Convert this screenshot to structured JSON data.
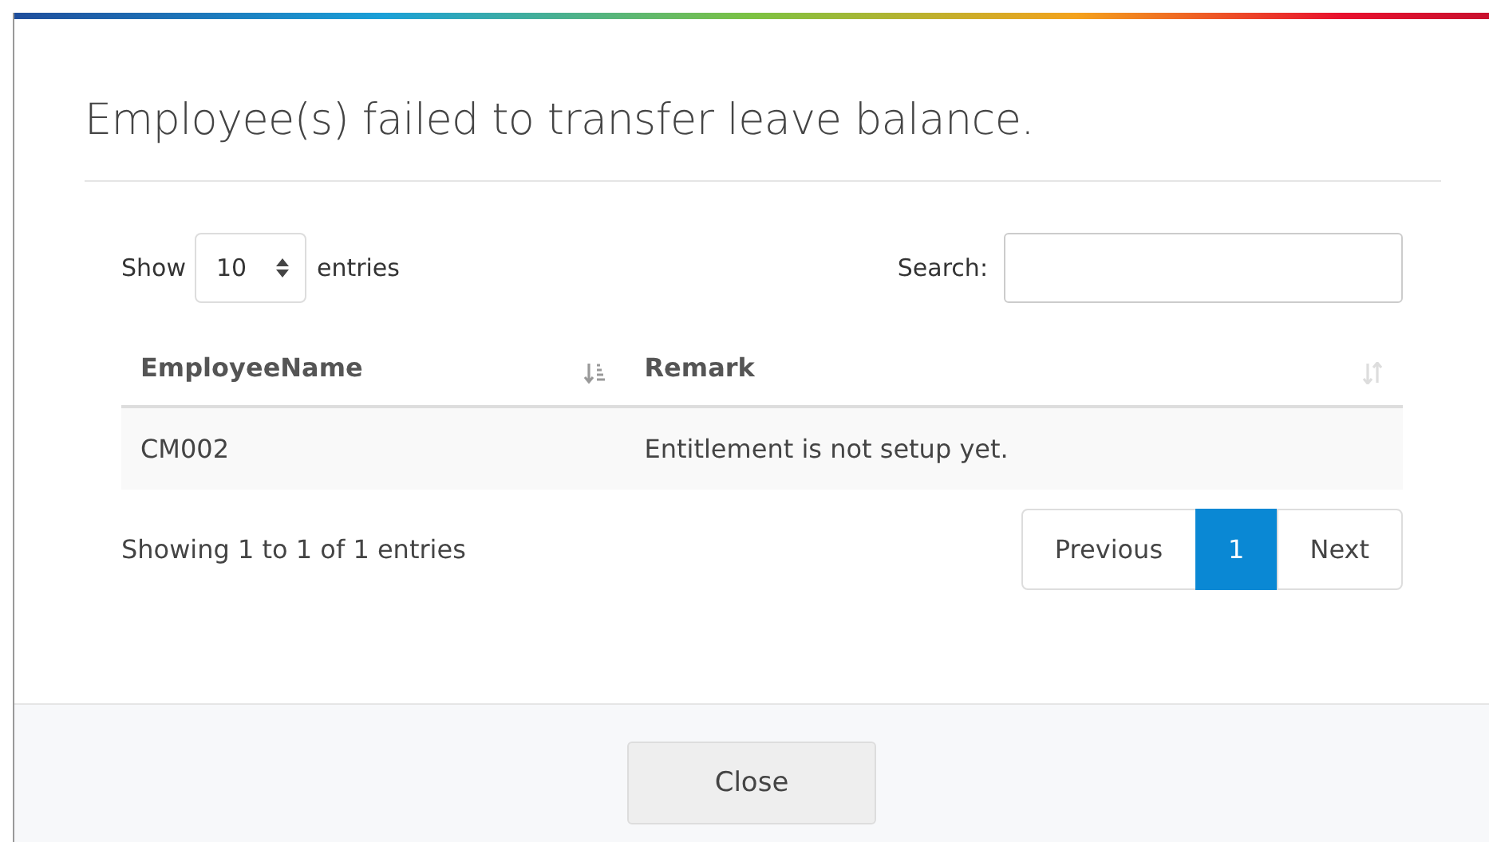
{
  "modal": {
    "title": "Employee(s) failed to transfer leave balance."
  },
  "length_control": {
    "label_before": "Show",
    "value": "10",
    "label_after": "entries"
  },
  "search": {
    "label": "Search:"
  },
  "table": {
    "columns": [
      {
        "label": "EmployeeName",
        "sorted": true
      },
      {
        "label": "Remark",
        "sorted": false
      }
    ],
    "rows": [
      {
        "cells": [
          "CM002",
          "Entitlement is not setup yet."
        ]
      }
    ]
  },
  "info": "Showing 1 to 1 of 1 entries",
  "pagination": [
    {
      "label": "Previous",
      "selected": false
    },
    {
      "label": "1",
      "selected": true
    },
    {
      "label": "Next",
      "selected": false
    }
  ],
  "footer": {
    "buttons": [
      "Close"
    ]
  }
}
